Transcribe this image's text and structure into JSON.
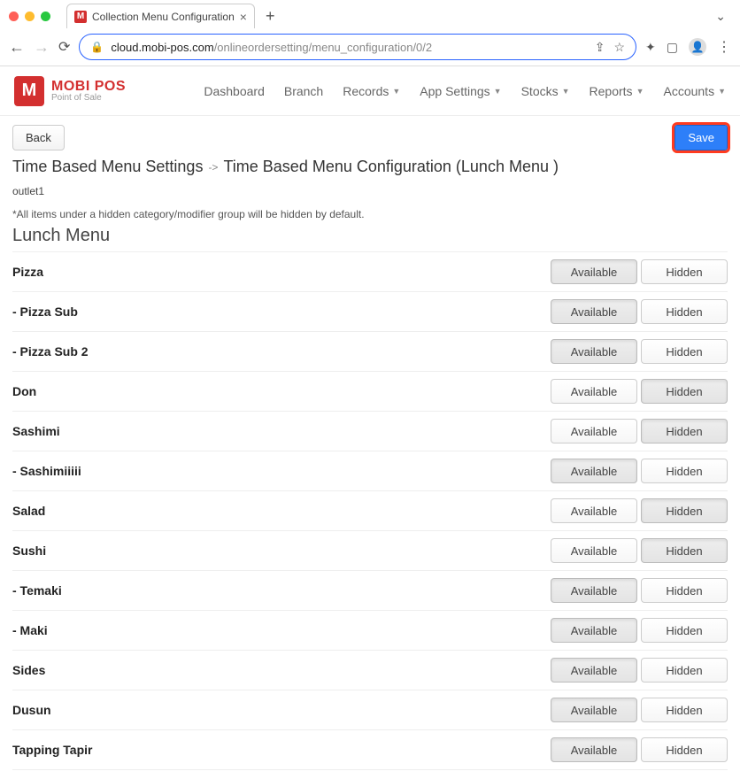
{
  "browser": {
    "tab_title": "Collection Menu Configuration",
    "url_host": "cloud.mobi-pos.com",
    "url_path": "/onlineordersetting/menu_configuration/0/2"
  },
  "brand": {
    "name": "MOBI POS",
    "tagline": "Point of Sale"
  },
  "nav": {
    "dashboard": "Dashboard",
    "branch": "Branch",
    "records": "Records",
    "app_settings": "App Settings",
    "stocks": "Stocks",
    "reports": "Reports",
    "accounts": "Accounts"
  },
  "buttons": {
    "back": "Back",
    "save": "Save",
    "available": "Available",
    "hidden": "Hidden"
  },
  "breadcrumb": {
    "parent": "Time Based Menu Settings",
    "child": "Time Based Menu Configuration (Lunch Menu )"
  },
  "outlet": "outlet1",
  "note": "*All items under a hidden category/modifier group will be hidden by default.",
  "menu_title": "Lunch Menu",
  "items": [
    {
      "name": "Pizza",
      "state": "available",
      "highlight": false
    },
    {
      "name": "- Pizza Sub",
      "state": "available",
      "highlight": false
    },
    {
      "name": "- Pizza Sub 2",
      "state": "available",
      "highlight": false
    },
    {
      "name": "Don",
      "state": "hidden",
      "highlight": true
    },
    {
      "name": "Sashimi",
      "state": "hidden",
      "highlight": true
    },
    {
      "name": "- Sashimiiiii",
      "state": "available",
      "highlight": false
    },
    {
      "name": "Salad",
      "state": "hidden",
      "highlight": true
    },
    {
      "name": "Sushi",
      "state": "hidden",
      "highlight": true
    },
    {
      "name": "- Temaki",
      "state": "available",
      "highlight": false
    },
    {
      "name": "- Maki",
      "state": "available",
      "highlight": false
    },
    {
      "name": "Sides",
      "state": "available",
      "highlight": false
    },
    {
      "name": "Dusun",
      "state": "available",
      "highlight": false
    },
    {
      "name": "Tapping Tapir",
      "state": "available",
      "highlight": false
    }
  ]
}
